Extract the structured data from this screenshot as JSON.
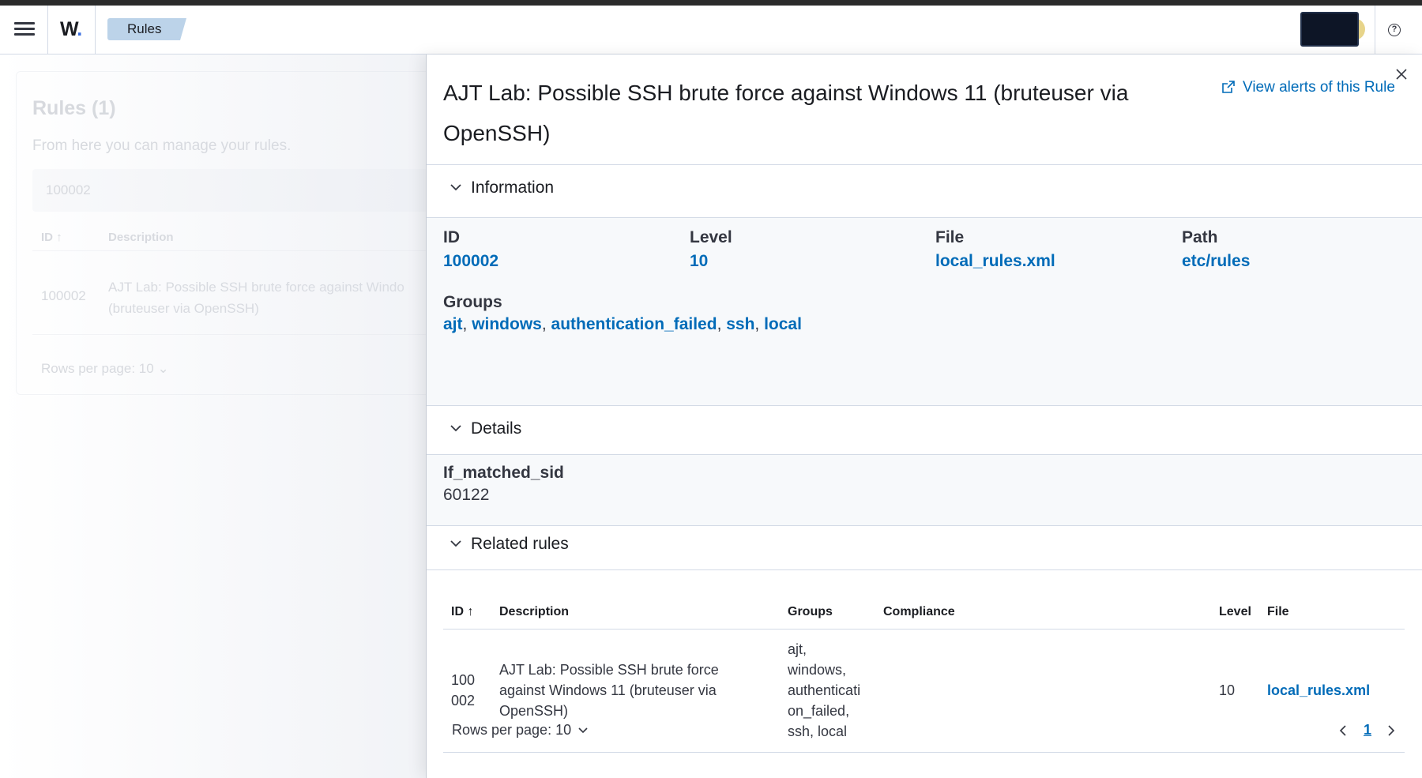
{
  "header": {
    "logo_text": "W",
    "logo_dot": ".",
    "breadcrumb": "Rules",
    "help_icon_label": "?"
  },
  "background_page": {
    "title": "Rules (1)",
    "subtitle": "From here you can manage your rules.",
    "search_value": "100002",
    "columns": [
      "ID",
      "Description"
    ],
    "row": {
      "id": "100002",
      "description": "AJT Lab: Possible SSH brute force against Windo",
      "description_line2": "(bruteuser via OpenSSH)"
    },
    "rows_per_page": "Rows per page: 10"
  },
  "flyout": {
    "title": "AJT Lab: Possible SSH brute force against Windows 11 (bruteuser via OpenSSH)",
    "view_alerts_label": "View alerts of this Rule",
    "information": {
      "section_label": "Information",
      "id_label": "ID",
      "id_value": "100002",
      "level_label": "Level",
      "level_value": "10",
      "file_label": "File",
      "file_value": "local_rules.xml",
      "path_label": "Path",
      "path_value": "etc/rules",
      "groups_label": "Groups",
      "groups": [
        "ajt",
        "windows",
        "authentication_failed",
        "ssh",
        "local"
      ],
      "sep": ", "
    },
    "details": {
      "section_label": "Details",
      "field_label": "If_matched_sid",
      "field_value": "60122"
    },
    "related_rules": {
      "section_label": "Related rules",
      "columns": {
        "id": "ID",
        "description": "Description",
        "groups": "Groups",
        "compliance": "Compliance",
        "level": "Level",
        "file": "File"
      },
      "row": {
        "id_line1": "100",
        "id_line2": "002",
        "description_line1": "AJT Lab: Possible SSH brute force",
        "description_line2": "against Windows 11 (bruteuser via",
        "description_line3": "OpenSSH)",
        "groups_line1": "ajt,",
        "groups_line2": "windows,",
        "groups_line3": "authenticati",
        "groups_line4": "on_failed,",
        "groups_line5": "ssh, local",
        "level": "10",
        "file": "local_rules.xml"
      },
      "rows_per_page": "Rows per page: 10",
      "current_page": "1"
    }
  },
  "colors": {
    "link": "#006bb8",
    "breadcrumb_bg": "#bcd3e9",
    "section_tint": "#f7f9fb"
  }
}
